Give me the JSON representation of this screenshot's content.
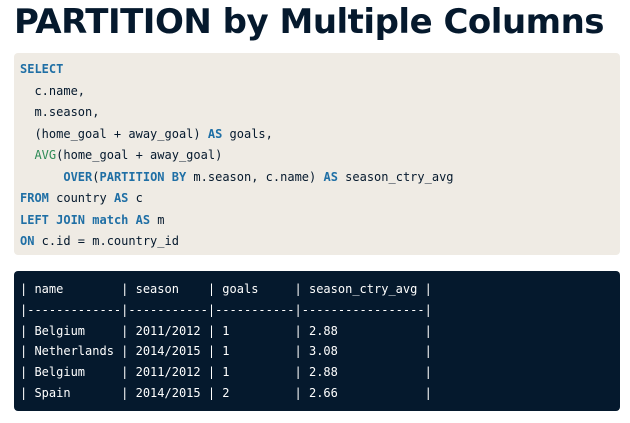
{
  "title": "PARTITION by Multiple Columns",
  "code": {
    "lines": [
      [
        {
          "t": "SELECT",
          "k": "kw"
        }
      ],
      [
        {
          "t": "  c.name,",
          "k": ""
        }
      ],
      [
        {
          "t": "  m.season,",
          "k": ""
        }
      ],
      [
        {
          "t": "  (home_goal + away_goal) ",
          "k": ""
        },
        {
          "t": "AS",
          "k": "kw"
        },
        {
          "t": " goals,",
          "k": ""
        }
      ],
      [
        {
          "t": "  ",
          "k": ""
        },
        {
          "t": "AVG",
          "k": "fn"
        },
        {
          "t": "(home_goal + away_goal)",
          "k": ""
        }
      ],
      [
        {
          "t": "      ",
          "k": ""
        },
        {
          "t": "OVER",
          "k": "kw"
        },
        {
          "t": "(",
          "k": ""
        },
        {
          "t": "PARTITION BY",
          "k": "kw"
        },
        {
          "t": " m.season, c.name) ",
          "k": ""
        },
        {
          "t": "AS",
          "k": "kw"
        },
        {
          "t": " season_ctry_avg",
          "k": ""
        }
      ],
      [
        {
          "t": "FROM",
          "k": "kw"
        },
        {
          "t": " country ",
          "k": ""
        },
        {
          "t": "AS",
          "k": "kw"
        },
        {
          "t": " c",
          "k": ""
        }
      ],
      [
        {
          "t": "LEFT JOIN",
          "k": "kw"
        },
        {
          "t": " ",
          "k": ""
        },
        {
          "t": "match",
          "k": "kw"
        },
        {
          "t": " ",
          "k": ""
        },
        {
          "t": "AS",
          "k": "kw"
        },
        {
          "t": " m",
          "k": ""
        }
      ],
      [
        {
          "t": "ON",
          "k": "kw"
        },
        {
          "t": " c.id = m.country_id",
          "k": ""
        }
      ]
    ]
  },
  "result": {
    "lines": [
      "| name        | season    | goals     | season_ctry_avg |",
      "|-------------|-----------|-----------|-----------------|",
      "| Belgium     | 2011/2012 | 1         | 2.88            |",
      "| Netherlands | 2014/2015 | 1         | 3.08            |",
      "| Belgium     | 2011/2012 | 1         | 2.88            |",
      "| Spain       | 2014/2015 | 2         | 2.66            |"
    ]
  }
}
